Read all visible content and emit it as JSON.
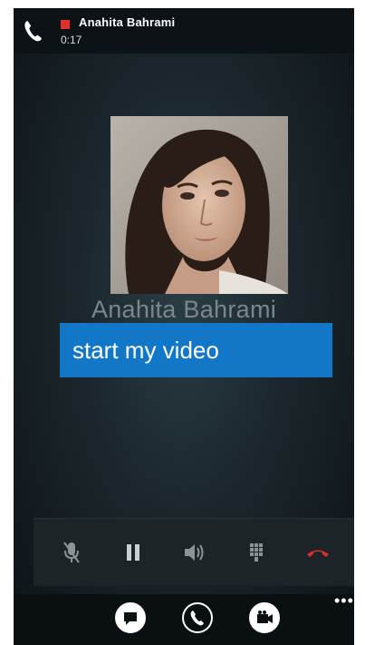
{
  "status": {
    "caller_name": "Anahita Bahrami",
    "timer": "0:17",
    "recording_indicator_color": "#e0312b"
  },
  "contact": {
    "name": "Anahita Bahrami",
    "photo": "contact-photo"
  },
  "actions": {
    "start_video_label": "start my video"
  },
  "controls": [
    {
      "name": "mute-icon"
    },
    {
      "name": "pause-icon"
    },
    {
      "name": "speaker-icon"
    },
    {
      "name": "keypad-icon"
    },
    {
      "name": "end-call-icon"
    }
  ],
  "app_bar": {
    "buttons": [
      "chat-icon",
      "phone-icon",
      "video-icon"
    ],
    "more_label": "•••"
  },
  "colors": {
    "accent": "#1377c7",
    "end_call": "#d92e2a",
    "background": "#1b262c"
  }
}
